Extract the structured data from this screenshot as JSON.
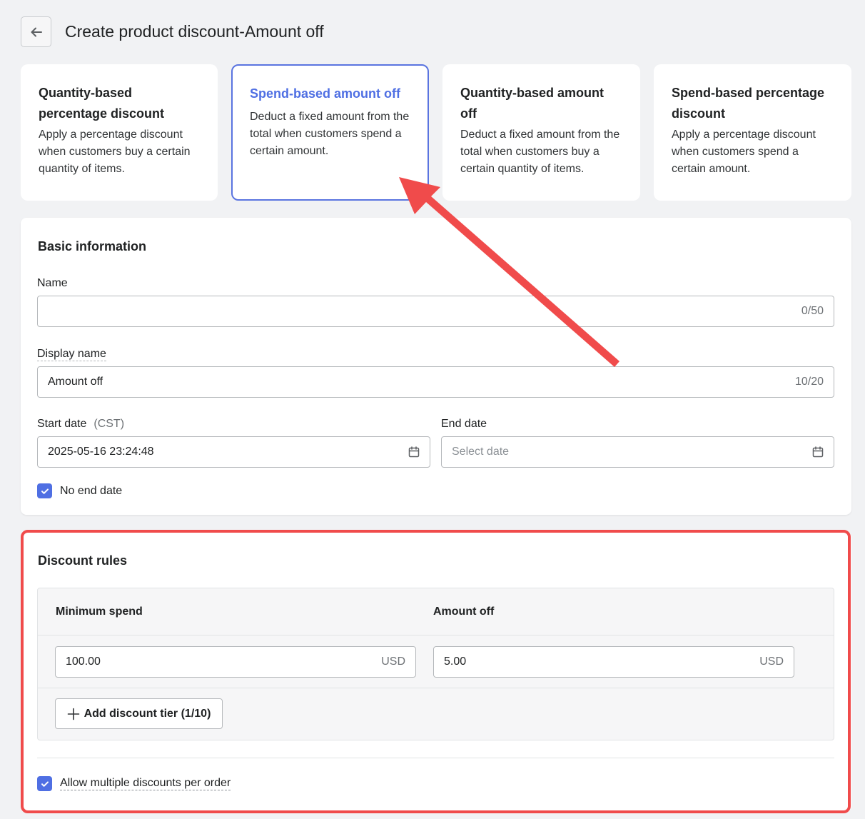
{
  "header": {
    "title": "Create product discount-Amount off"
  },
  "discount_types": [
    {
      "title": "Quantity-based percentage discount",
      "description": "Apply a percentage discount when customers buy a certain quantity of items.",
      "selected": false
    },
    {
      "title": "Spend-based amount off",
      "description": "Deduct a fixed amount from the total when customers spend a certain amount.",
      "selected": true
    },
    {
      "title": "Quantity-based amount off",
      "description": "Deduct a fixed amount from the total when customers buy a certain quantity of items.",
      "selected": false
    },
    {
      "title": "Spend-based percentage discount",
      "description": "Apply a percentage discount when customers spend a certain amount.",
      "selected": false
    }
  ],
  "basic": {
    "title": "Basic information",
    "name_label": "Name",
    "name_value": "",
    "name_counter": "0/50",
    "display_name_label": "Display name",
    "display_name_value": "Amount off",
    "display_name_counter": "10/20",
    "start_date_label": "Start date",
    "start_date_hint": "(CST)",
    "start_date_value": "2025-05-16 23:24:48",
    "end_date_label": "End date",
    "end_date_placeholder": "Select date",
    "no_end_date_label": "No end date",
    "no_end_date_checked": true
  },
  "rules": {
    "title": "Discount rules",
    "min_spend_header": "Minimum spend",
    "amount_off_header": "Amount off",
    "tiers": [
      {
        "min_spend": "100.00",
        "min_spend_currency": "USD",
        "amount_off": "5.00",
        "amount_off_currency": "USD"
      }
    ],
    "add_tier_label": "Add discount tier (1/10)",
    "allow_multiple_label": "Allow multiple discounts per order",
    "allow_multiple_checked": true
  },
  "annotation": {
    "color": "#f04b4b"
  },
  "colors": {
    "accent": "#4f6fe3",
    "background": "#f1f2f4"
  }
}
